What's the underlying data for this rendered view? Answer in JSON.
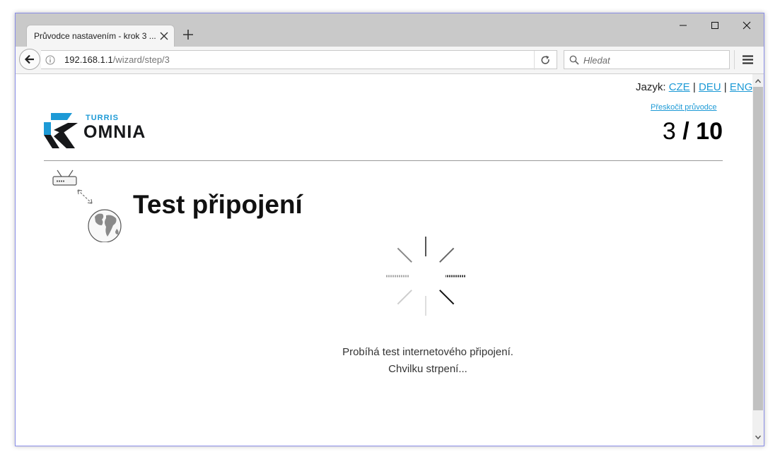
{
  "browser": {
    "tab_title": "Průvodce nastavením - krok 3 ...",
    "url_host": "192.168.1.1",
    "url_path": "/wizard/step/3",
    "search_placeholder": "Hledat"
  },
  "header": {
    "language_label": "Jazyk:",
    "languages": [
      "CZE",
      "DEU",
      "ENG"
    ],
    "language_separator": "|",
    "skip_link": "Přeskočit průvodce",
    "step_current": "3",
    "step_separator": "/",
    "step_total": "10",
    "logo_small": "TURRIS",
    "logo_big": "OMNIA"
  },
  "main": {
    "title": "Test připojení",
    "status_line1": "Probíhá test internetového připojení.",
    "status_line2": "Chvilku strpení..."
  },
  "colors": {
    "accent": "#1d9ad6",
    "logo_dark": "#17181a"
  },
  "icons": [
    "back-arrow-icon",
    "info-icon",
    "reload-icon",
    "search-icon",
    "hamburger-menu-icon",
    "router-icon",
    "globe-icon",
    "loading-spinner-icon"
  ]
}
